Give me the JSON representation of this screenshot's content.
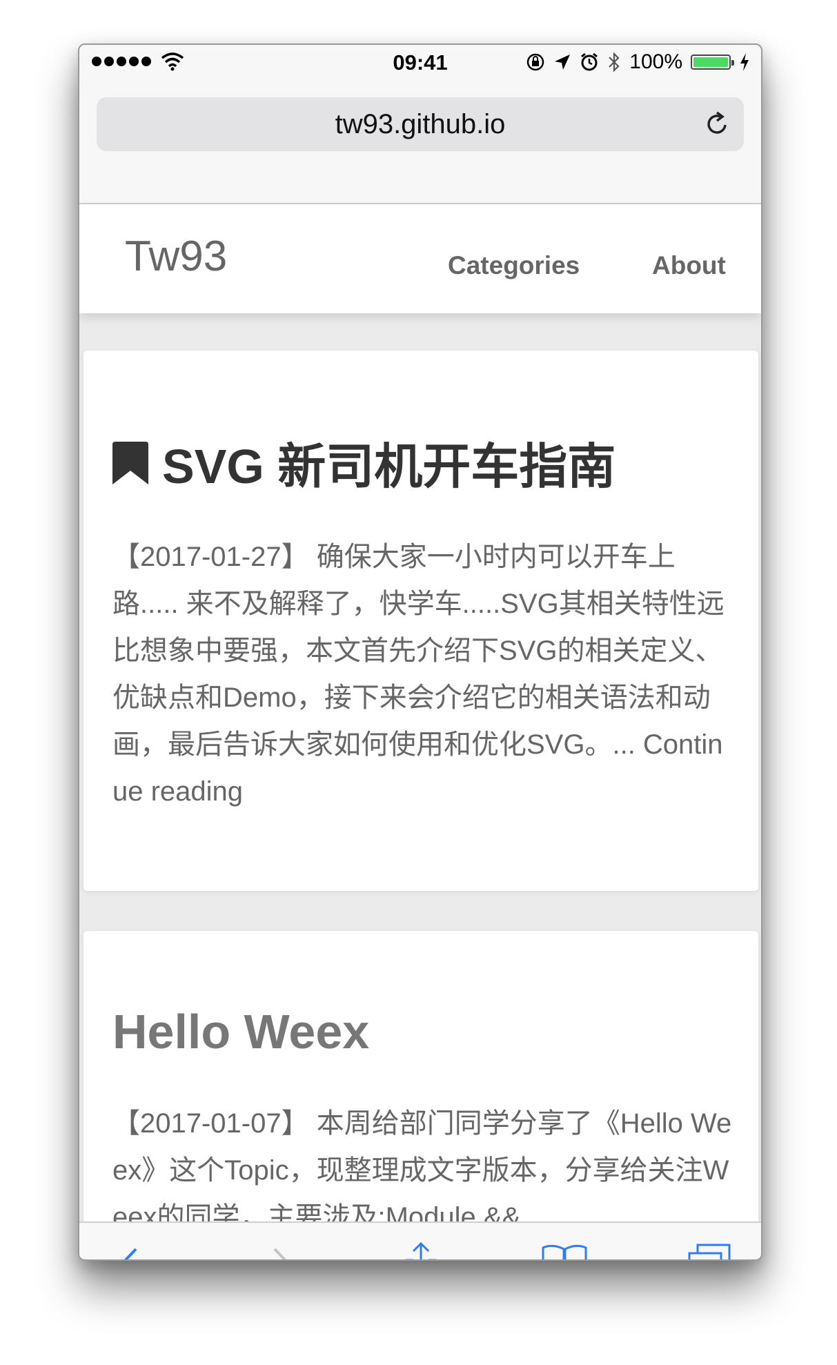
{
  "status_bar": {
    "time": "09:41",
    "battery_text": "100%",
    "battery_level": 1.0
  },
  "browser": {
    "url": "tw93.github.io"
  },
  "site": {
    "brand": "Tw93",
    "nav": [
      "Categories",
      "About"
    ]
  },
  "posts": [
    {
      "title": "SVG 新司机开车指南",
      "excerpt": "【2017-01-27】 确保大家一小时内可以开车上路..... 来不及解释了，快学车.....SVG其相关特性远比想象中要强，本文首先介绍下SVG的相关定义、优缺点和Demo，接下来会介绍它的相关语法和动画，最后告诉大家如何使用和优化SVG。... Continue reading",
      "bookmarked": true
    },
    {
      "title": "Hello Weex",
      "excerpt": "【2017-01-07】 本周给部门同学分享了《Hello Weex》这个Topic，现整理成文字版本，分享给关注Weex的同学，主要涉及:Module &&",
      "bookmarked": false
    }
  ],
  "colors": {
    "accent": "#2f7cf6",
    "battery": "#4cd964",
    "text": "#666666"
  },
  "icons": {
    "toolbar": [
      "back-icon",
      "forward-icon",
      "share-icon",
      "bookmarks-icon",
      "tabs-icon"
    ]
  }
}
